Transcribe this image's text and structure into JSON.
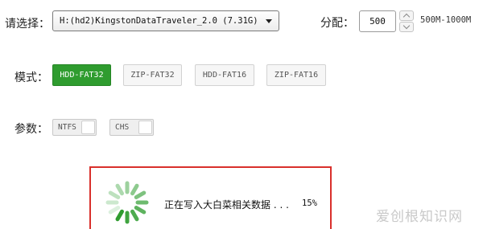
{
  "device": {
    "label": "请选择：",
    "selected": "H:(hd2)KingstonDataTraveler_2.0 (7.31G)"
  },
  "allocation": {
    "label": "分配：",
    "value": "500",
    "range": "500M-1000M"
  },
  "mode": {
    "label": "模式：",
    "options": [
      "HDD-FAT32",
      "ZIP-FAT32",
      "HDD-FAT16",
      "ZIP-FAT16"
    ],
    "selected_index": 0
  },
  "params": {
    "label": "参数：",
    "toggles": [
      {
        "label": "NTFS",
        "on": false
      },
      {
        "label": "CHS",
        "on": false
      }
    ]
  },
  "progress": {
    "status": "正在写入大白菜相关数据 . . .",
    "percent_text": "15%",
    "percent": 15
  },
  "watermark": "爱创根知识网",
  "colors": {
    "accent_green": "#2f9c2f",
    "highlight_red": "#d9302c"
  }
}
